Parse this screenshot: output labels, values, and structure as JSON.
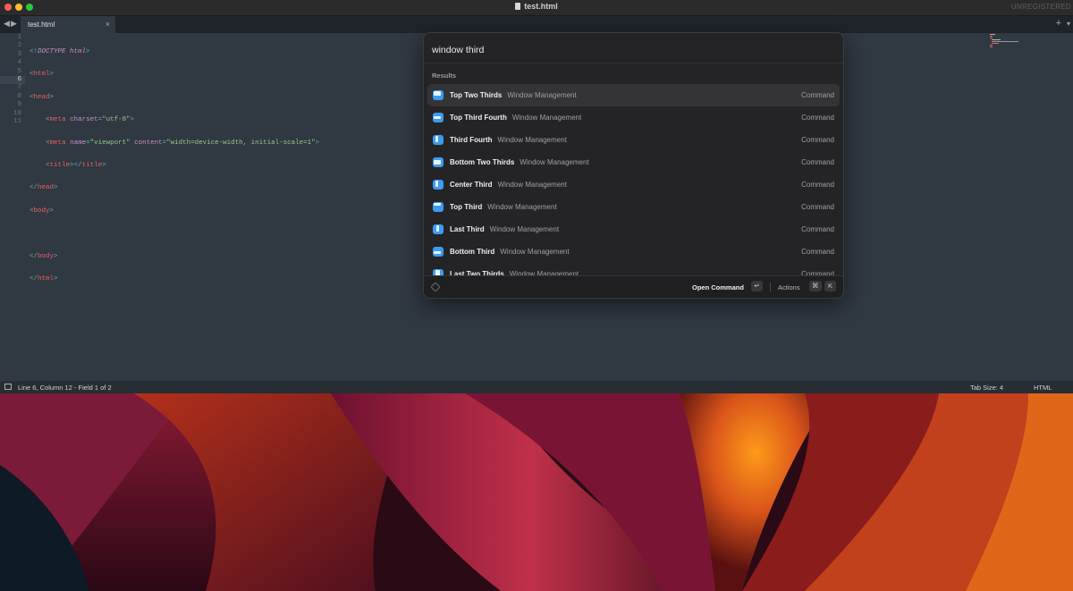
{
  "window": {
    "title": "test.html",
    "watermark": "UNREGISTERED"
  },
  "tabs": [
    {
      "label": "test.html",
      "close": "×"
    }
  ],
  "tabbar": {
    "back": "◀",
    "forward": "▶",
    "add": "+",
    "menu": "▾"
  },
  "editor": {
    "line_numbers": [
      "1",
      "2",
      "3",
      "4",
      "5",
      "6",
      "7",
      "8",
      "9",
      "10",
      "11"
    ],
    "active_line": "6"
  },
  "statusbar": {
    "position": "Line 6, Column 12 - Field 1 of 2",
    "tab_size": "Tab Size: 4",
    "syntax": "HTML"
  },
  "palette": {
    "search_value": "window third",
    "section": "Results",
    "results": [
      {
        "title": "Top Two Thirds",
        "subtitle": "Window Management",
        "type": "Command",
        "selected": true
      },
      {
        "title": "Top Third Fourth",
        "subtitle": "Window Management",
        "type": "Command"
      },
      {
        "title": "Third Fourth",
        "subtitle": "Window Management",
        "type": "Command"
      },
      {
        "title": "Bottom Two Thirds",
        "subtitle": "Window Management",
        "type": "Command"
      },
      {
        "title": "Center Third",
        "subtitle": "Window Management",
        "type": "Command"
      },
      {
        "title": "Top Third",
        "subtitle": "Window Management",
        "type": "Command"
      },
      {
        "title": "Last Third",
        "subtitle": "Window Management",
        "type": "Command"
      },
      {
        "title": "Bottom Third",
        "subtitle": "Window Management",
        "type": "Command"
      },
      {
        "title": "Last Two Thirds",
        "subtitle": "Window Management",
        "type": "Command"
      }
    ],
    "footer": {
      "primary_action": "Open Command",
      "primary_key": "↵",
      "actions_label": "Actions",
      "actions_keys": [
        "⌘",
        "K"
      ]
    }
  },
  "colors": {
    "editor_bg": "#303841",
    "palette_bg": "#242426",
    "accent_blue": "#3d9bf0",
    "tag_red": "#ec5f66",
    "string_green": "#99c794"
  }
}
